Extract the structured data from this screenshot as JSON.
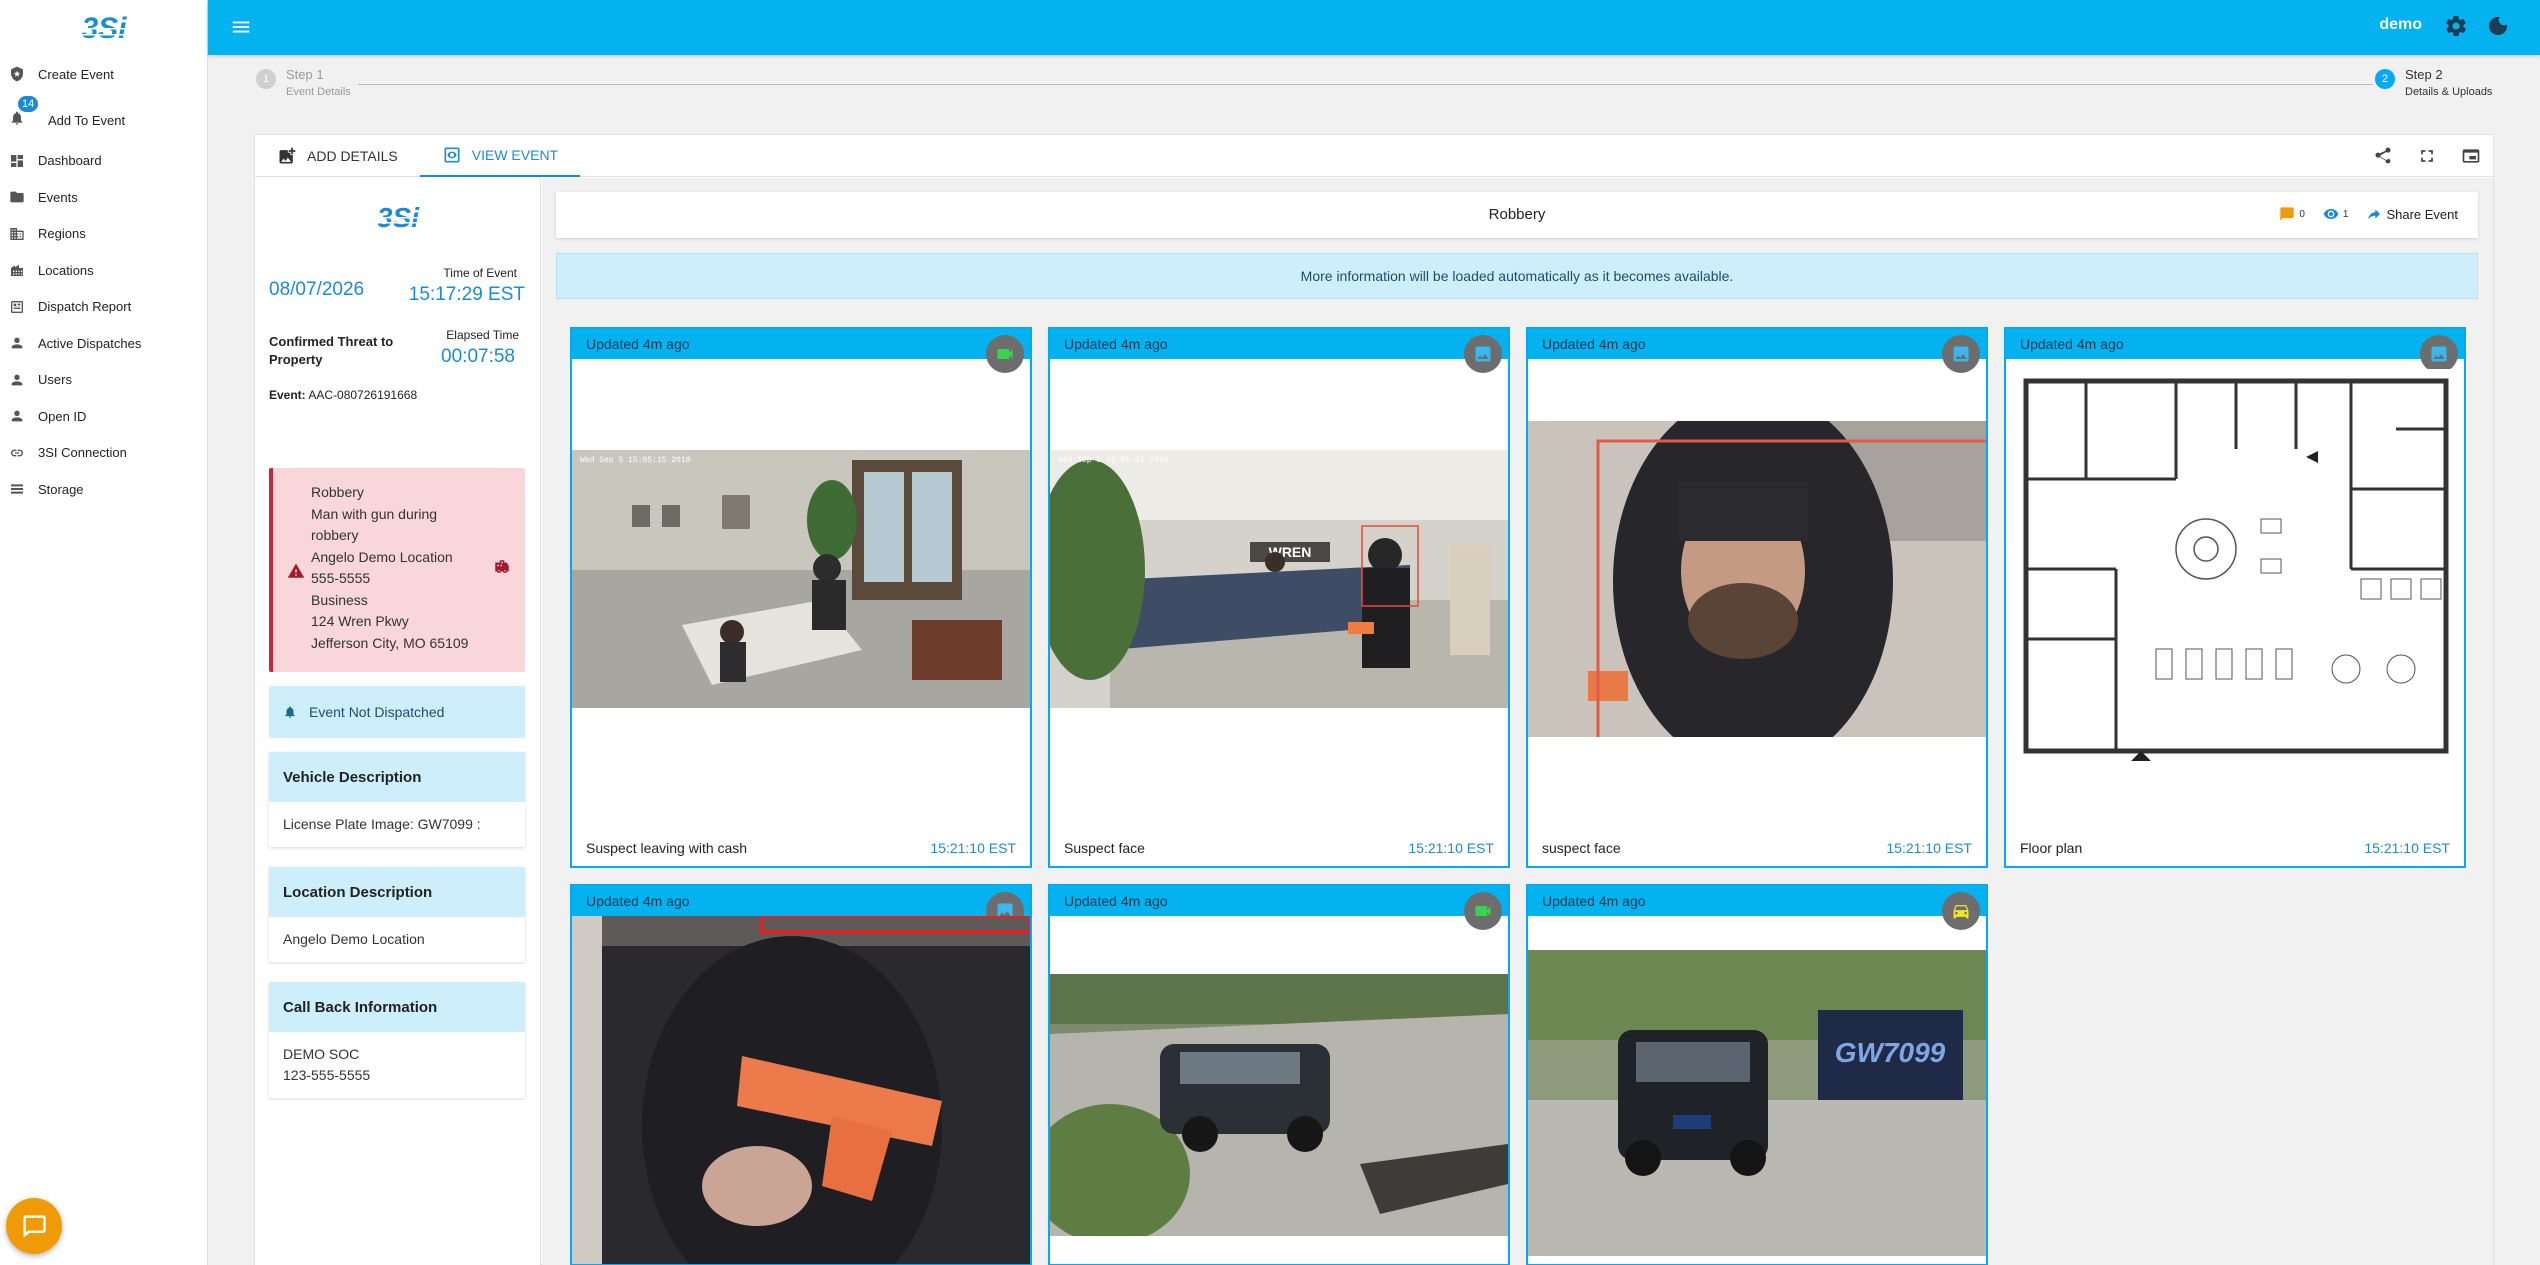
{
  "sidebar": {
    "items": [
      {
        "label": "Create Event",
        "icon": "shield-star-icon"
      },
      {
        "label": "Add To Event",
        "icon": "bell-plus-icon",
        "badge": "14"
      },
      {
        "label": "Dashboard",
        "icon": "dashboard-icon"
      },
      {
        "label": "Events",
        "icon": "folder-icon"
      },
      {
        "label": "Regions",
        "icon": "buildings-icon"
      },
      {
        "label": "Locations",
        "icon": "building-icon"
      },
      {
        "label": "Dispatch Report",
        "icon": "report-icon"
      },
      {
        "label": "Active Dispatches",
        "icon": "person-icon"
      },
      {
        "label": "Users",
        "icon": "person-icon"
      },
      {
        "label": "Open ID",
        "icon": "person-icon"
      },
      {
        "label": "3SI Connection",
        "icon": "connection-icon"
      },
      {
        "label": "Storage",
        "icon": "list-icon"
      }
    ]
  },
  "header": {
    "user": "demo",
    "colors": {
      "accent": "#03b2ef",
      "accent_dark": "#1a8bd6",
      "alert": "#c62839",
      "chat": "#f09a06"
    }
  },
  "stepper": {
    "step1": {
      "num": "1",
      "title": "Step 1",
      "sub": "Event Details"
    },
    "step2": {
      "num": "2",
      "title": "Step 2",
      "sub": "Details & Uploads"
    }
  },
  "tabs": {
    "add_details": "ADD DETAILS",
    "view_event": "VIEW EVENT"
  },
  "details": {
    "date": "08/07/2026",
    "time_label": "Time of Event",
    "time_value": "15:17:29 EST",
    "threat": "Confirmed Threat to Property",
    "elapsed_label": "Elapsed Time",
    "elapsed_value": "00:07:58",
    "event_label": "Event:",
    "event_id": "AAC-080726191668",
    "alert_lines": [
      "Robbery",
      "Man with gun during",
      "robbery",
      "Angelo Demo Location",
      "555-5555",
      "Business",
      "124 Wren Pkwy",
      "Jefferson City, MO 65109"
    ],
    "dispatch_status": "Event Not Dispatched",
    "vehicle": {
      "title": "Vehicle Description",
      "body": "License Plate Image: GW7099 :"
    },
    "location": {
      "title": "Location Description",
      "body": "Angelo Demo Location"
    },
    "callback": {
      "title": "Call Back Information",
      "line1": "DEMO SOC",
      "line2": "123-555-5555"
    }
  },
  "event": {
    "title": "Robbery",
    "comments_count": "0",
    "views_count": "1",
    "share_label": "Share Event",
    "banner": "More information will be loaded automatically as it becomes available."
  },
  "media": [
    {
      "updated": "Updated 4m ago",
      "type": "video",
      "caption": "Suspect leaving with cash",
      "time": "15:21:10 EST"
    },
    {
      "updated": "Updated 4m ago",
      "type": "image",
      "caption": "Suspect face",
      "time": "15:21:10 EST"
    },
    {
      "updated": "Updated 4m ago",
      "type": "image",
      "caption": "suspect face",
      "time": "15:21:10 EST"
    },
    {
      "updated": "Updated 4m ago",
      "type": "image",
      "caption": "Floor plan",
      "time": "15:21:10 EST"
    },
    {
      "updated": "Updated 4m ago",
      "type": "image",
      "caption": "",
      "time": ""
    },
    {
      "updated": "Updated 4m ago",
      "type": "video",
      "caption": "",
      "time": ""
    },
    {
      "updated": "Updated 4m ago",
      "type": "vehicle",
      "caption": "",
      "time": ""
    }
  ]
}
